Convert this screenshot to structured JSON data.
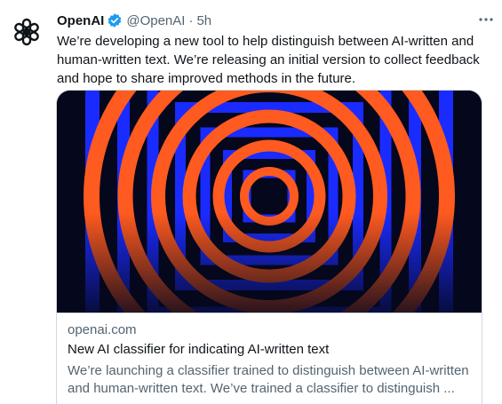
{
  "author": {
    "name": "OpenAI",
    "handle": "@OpenAI",
    "separator": "·",
    "time": "5h",
    "avatar_icon": "openai-logo-icon",
    "verified_icon": "verified-badge-icon",
    "verified_color": "#1d9bf0"
  },
  "tweet": {
    "text": "We’re developing a new tool to help distinguish between AI-written and human-written text. We’re releasing an initial version to collect feedback and hope to share improved methods in the future."
  },
  "card": {
    "domain": "openai.com",
    "title": "New AI classifier for indicating AI-written text",
    "description": "We’re launching a classifier trained to distinguish between AI-written and human-written text. We’ve trained a classifier to distinguish ..."
  },
  "menu": {
    "icon": "more-options-icon"
  },
  "colors": {
    "ring_orange": "#ff5a1f",
    "square_blue": "#1a2bff",
    "image_background": "#05071c"
  }
}
